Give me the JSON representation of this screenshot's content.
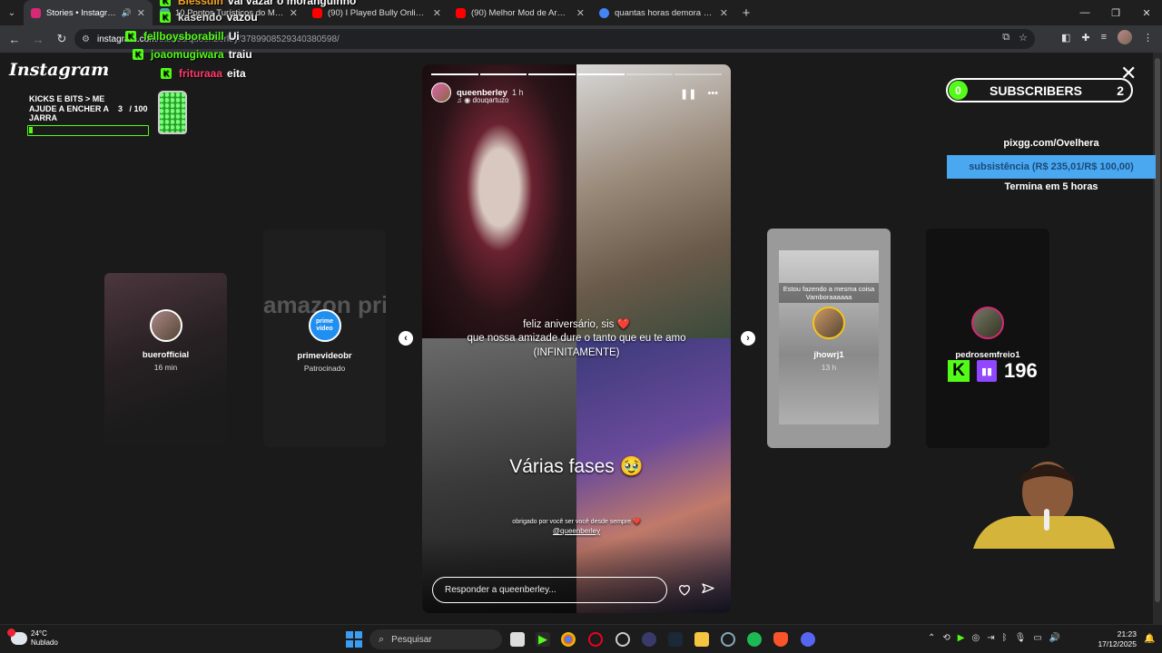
{
  "browser": {
    "tabs": [
      {
        "title": "Stories • Instagram",
        "active": true,
        "favicon_color": "#d62976"
      },
      {
        "title": "10 Pontos Turísticos do Maranhão",
        "active": false,
        "favicon_color": "#4a9"
      },
      {
        "title": "(90) I Played Bully Online - YouTube",
        "active": false,
        "favicon_color": "#f00"
      },
      {
        "title": "(90) Melhor Mod de Arma no Minecraft",
        "active": false,
        "favicon_color": "#f00"
      },
      {
        "title": "quantas horas demora pra zerar",
        "active": false,
        "favicon_color": "#4285f4"
      }
    ],
    "url_host": "instagram.com",
    "url_path": "/stories/queenberley/3789908529340380598/"
  },
  "instagram": {
    "logo": "Instagram",
    "story": {
      "username": "queenberley",
      "time": "1 h",
      "music": "douqartuzo",
      "caption_line1": "feliz aniversário, sis ❤️",
      "caption_line2": "que nossa amizade dure o tanto que eu te amo",
      "caption_line3": "(INFINITAMENTE)",
      "caption_big": "Várias fases 🥹",
      "caption_small": "obrigado por você ser você desde sempre ❤️",
      "mention": "@queenberley",
      "reply_placeholder": "Responder a queenberley..."
    },
    "side_stories": [
      {
        "user": "buerofficial",
        "time": "16 min"
      },
      {
        "user": "primevideobr",
        "time": "Patrocinado"
      },
      {
        "user": "jhowrj1",
        "time": "13 h",
        "overlay_text": "Estou fazendo a mesma coisa Vamboraaaaaa"
      },
      {
        "user": "pedrosemfreio1",
        "time": ""
      }
    ],
    "prime_logo": "amazon prim",
    "prime_badge": "prime video"
  },
  "overlay": {
    "jar_title": "KICKS E BITS > ME AJUDE A ENCHER A JARRA",
    "jar_current": "3",
    "jar_goal": "/ 100",
    "jar_progress": 0.03,
    "chat": [
      {
        "user": "Blessdin",
        "msg": "vai vazar o moranguinho",
        "color": "#f5a623"
      },
      {
        "user": "kasendo",
        "msg": "vazou",
        "color": "#e0e0e0"
      },
      {
        "user": "fellboysborabill",
        "msg": "Ui",
        "color": "#53fc18"
      },
      {
        "user": "joaomugiwara",
        "msg": "traiu",
        "color": "#53fc18"
      },
      {
        "user": "frituraaa",
        "msg": "eita",
        "color": "#ff3b6b"
      }
    ],
    "subs_count": "0",
    "subs_label": "SUBSCRIBERS",
    "subs_goal": "2",
    "pix_url": "pixgg.com/Ovelhera",
    "pix_goal": "subsistência (R$ 235,01/R$ 100,00)",
    "pix_end": "Termina em 5 horas",
    "viewer_count": "196"
  },
  "taskbar": {
    "temp": "24°C",
    "weather": "Nublado",
    "search": "Pesquisar",
    "time": "21:23",
    "date": "17/12/2025"
  }
}
